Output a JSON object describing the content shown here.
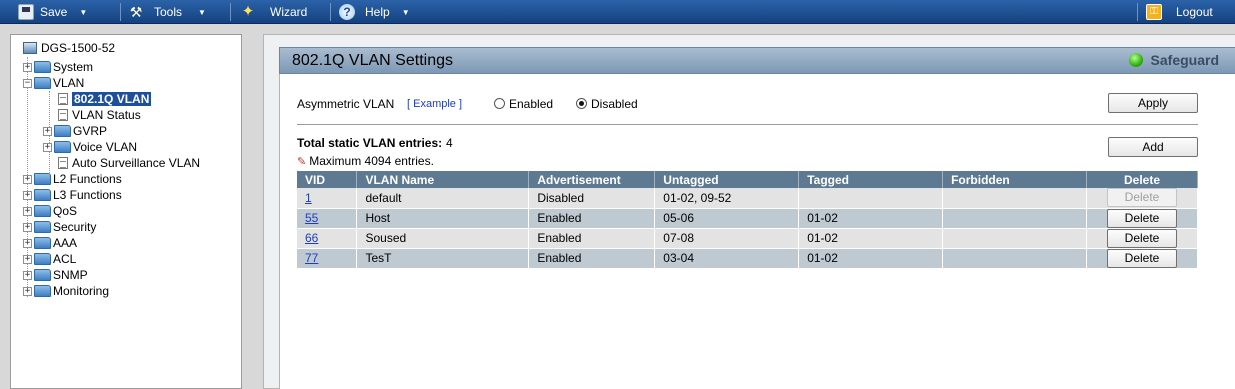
{
  "toolbar": {
    "save_label": "Save",
    "tools_label": "Tools",
    "wizard_label": "Wizard",
    "help_label": "Help",
    "logout_label": "Logout"
  },
  "tree": {
    "root": "DGS-1500-52",
    "items": [
      {
        "label": "System"
      },
      {
        "label": "VLAN"
      },
      {
        "label": "802.1Q VLAN"
      },
      {
        "label": "VLAN Status"
      },
      {
        "label": "GVRP"
      },
      {
        "label": "Voice VLAN"
      },
      {
        "label": "Auto Surveillance VLAN"
      },
      {
        "label": "L2 Functions"
      },
      {
        "label": "L3 Functions"
      },
      {
        "label": "QoS"
      },
      {
        "label": "Security"
      },
      {
        "label": "AAA"
      },
      {
        "label": "ACL"
      },
      {
        "label": "SNMP"
      },
      {
        "label": "Monitoring"
      }
    ]
  },
  "page": {
    "title": "802.1Q VLAN Settings",
    "safeguard": "Safeguard",
    "asym_label": "Asymmetric VLAN",
    "example_link": "[ Example ]",
    "enabled_label": "Enabled",
    "disabled_label": "Disabled",
    "asym_value": "Disabled",
    "apply_label": "Apply",
    "add_label": "Add",
    "total_label": "Total static VLAN entries:",
    "total_value": "4",
    "max_entries": "Maximum 4094 entries."
  },
  "table": {
    "headers": [
      "VID",
      "VLAN Name",
      "Advertisement",
      "Untagged",
      "Tagged",
      "Forbidden",
      "Delete"
    ],
    "rows": [
      {
        "vid": "1",
        "name": "default",
        "advertisement": "Disabled",
        "untagged": "01-02, 09-52",
        "tagged": "",
        "forbidden": "",
        "delete": "Delete"
      },
      {
        "vid": "55",
        "name": "Host",
        "advertisement": "Enabled",
        "untagged": "05-06",
        "tagged": "01-02",
        "forbidden": "",
        "delete": "Delete"
      },
      {
        "vid": "66",
        "name": "Soused",
        "advertisement": "Enabled",
        "untagged": "07-08",
        "tagged": "01-02",
        "forbidden": "",
        "delete": "Delete"
      },
      {
        "vid": "77",
        "name": "TesT",
        "advertisement": "Enabled",
        "untagged": "03-04",
        "tagged": "01-02",
        "forbidden": "",
        "delete": "Delete"
      }
    ]
  },
  "colors": {
    "toolbar": "#1d4f93",
    "selected": "#1d4f9b",
    "table_header": "#5e7a92",
    "status_led": "#2fb20e"
  }
}
